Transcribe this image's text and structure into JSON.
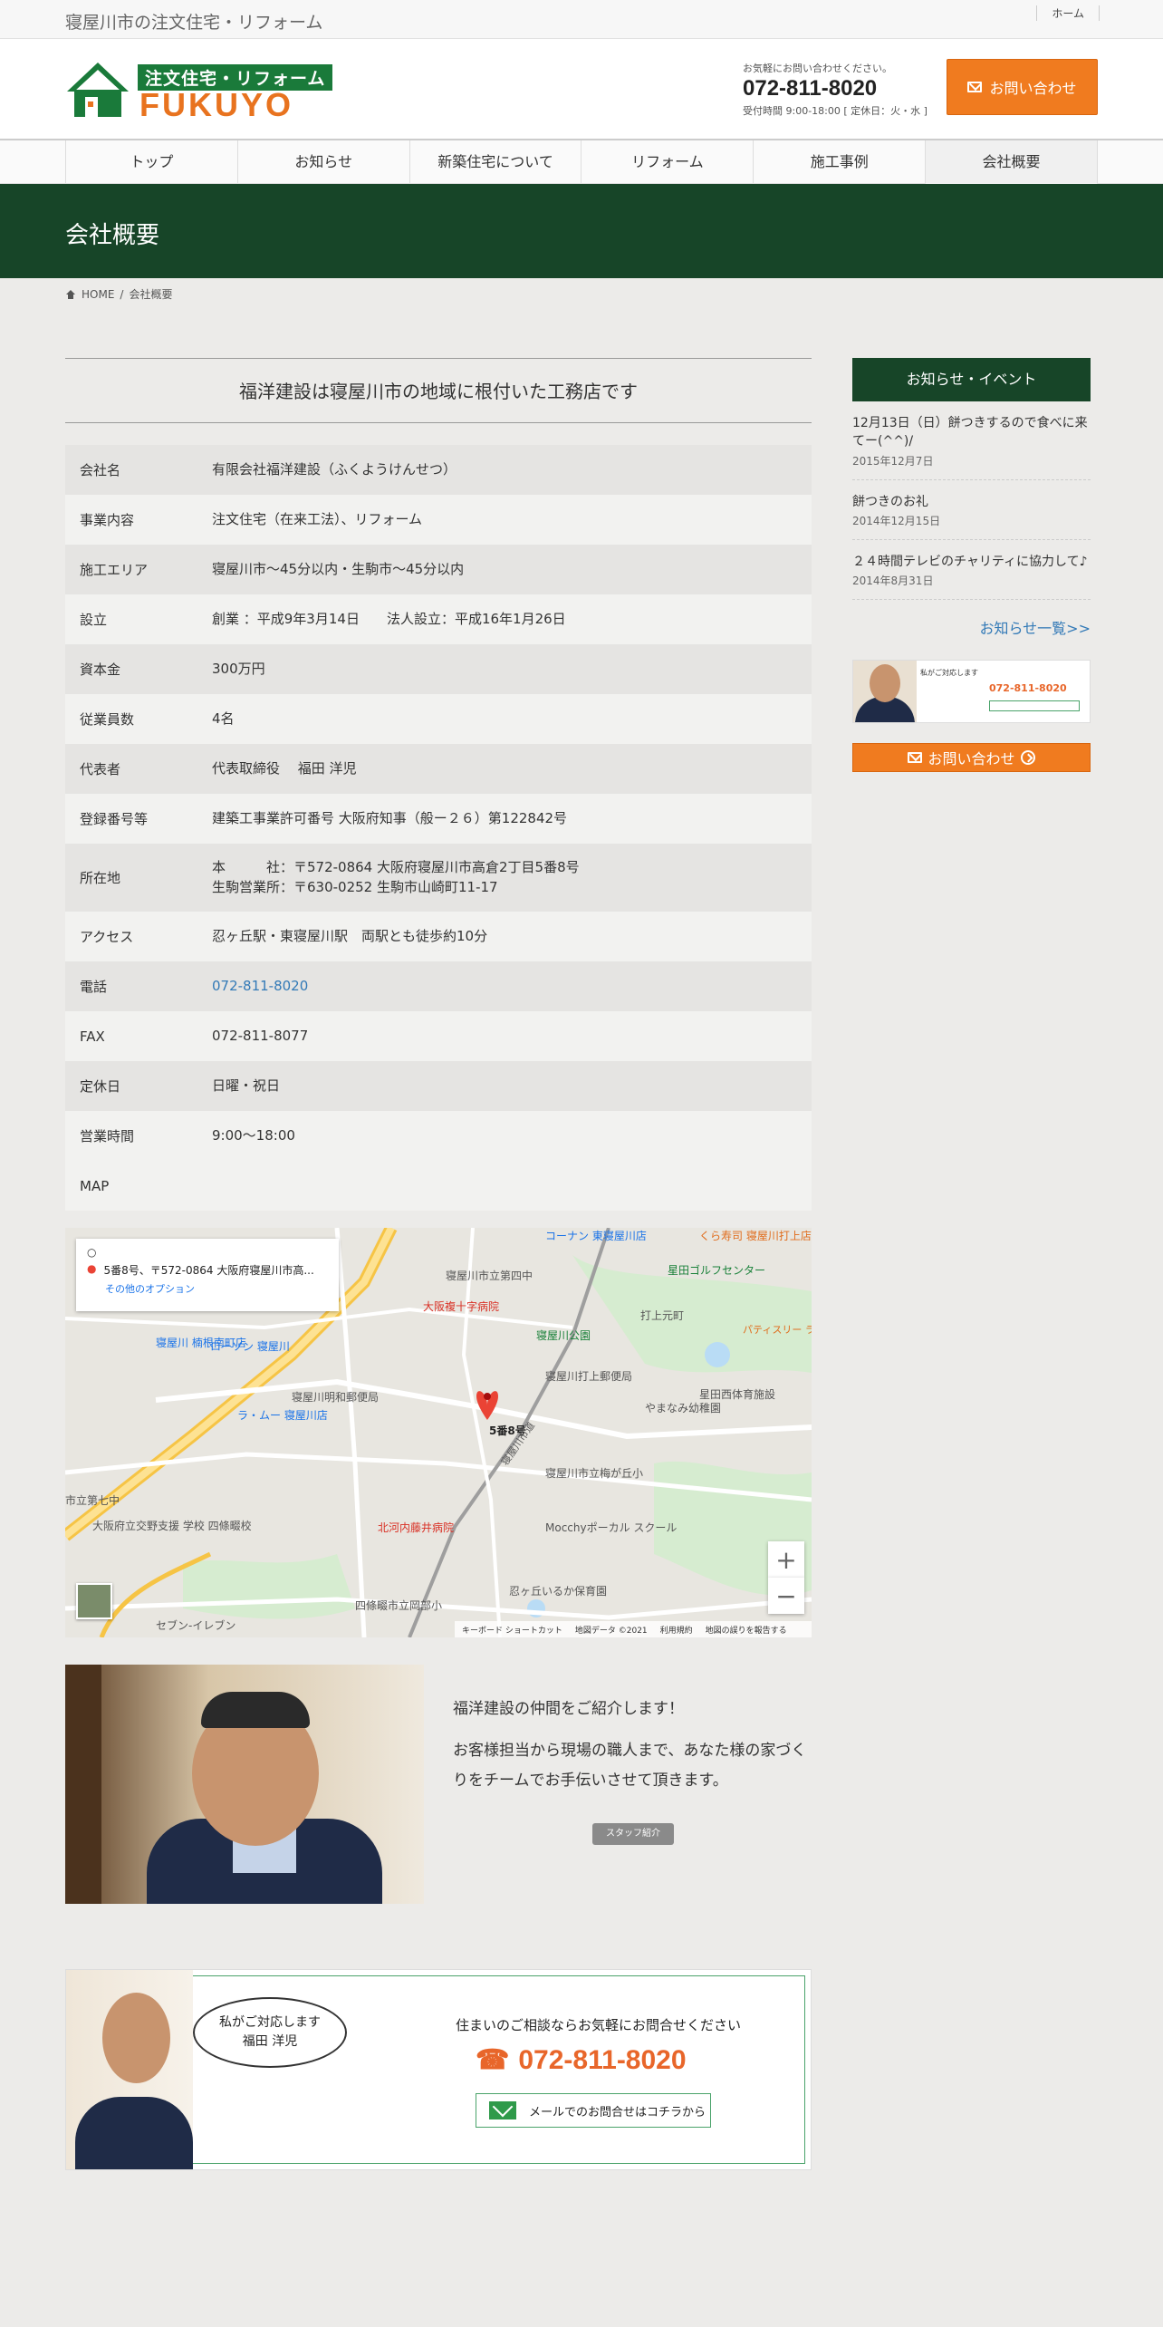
{
  "topbar": {
    "tagline": "寝屋川市の注文住宅・リフォーム",
    "nav_home": "ホーム"
  },
  "header": {
    "logo_sub": "注文住宅・リフォーム",
    "logo_main": "FUKUYO",
    "contact_lead": "お気軽にお問い合わせください。",
    "tel": "072-811-8020",
    "hours": "受付時間 9:00-18:00 [ 定休日：火・水 ]",
    "contact_button": "お問い合わせ"
  },
  "gnav": [
    "トップ",
    "お知らせ",
    "新築住宅について",
    "リフォーム",
    "施工事例",
    "会社概要"
  ],
  "page": {
    "title": "会社概要",
    "breadcrumb_home": "HOME",
    "breadcrumb_current": "会社概要"
  },
  "main": {
    "lead_title": "福洋建設は寝屋川市の地域に根付いた工務店です",
    "table": [
      {
        "k": "会社名",
        "v": "有限会社福洋建設（ふくようけんせつ）"
      },
      {
        "k": "事業内容",
        "v": "注文住宅（在来工法）、リフォーム"
      },
      {
        "k": "施工エリア",
        "v": "寝屋川市～45分以内・生駒市～45分以内"
      },
      {
        "k": "設立",
        "v": "創業 ：平成9年3月14日　　法人設立：平成16年1月26日"
      },
      {
        "k": "資本金",
        "v": "300万円"
      },
      {
        "k": "従業員数",
        "v": "4名"
      },
      {
        "k": "代表者",
        "v": "代表取締役　 福田 洋児"
      },
      {
        "k": "登録番号等",
        "v": "建築工事業許可番号 大阪府知事（般ー２６）第122842号"
      },
      {
        "k": "所在地",
        "v": "本　　　社：〒572-0864 大阪府寝屋川市高倉2丁目5番8号",
        "v2": "生駒営業所：〒630-0252 生駒市山崎町11-17"
      },
      {
        "k": "アクセス",
        "v": "忍ヶ丘駅・東寝屋川駅　両駅とも徒歩約10分"
      },
      {
        "k": "電話",
        "v": "072-811-8020"
      },
      {
        "k": "FAX",
        "v": "072-811-8077"
      },
      {
        "k": "定休日",
        "v": "日曜・祝日"
      },
      {
        "k": "営業時間",
        "v": "9:00～18:00"
      },
      {
        "k": "MAP",
        "v": ""
      }
    ]
  },
  "map": {
    "card_address": "5番8号、〒572-0864 大阪府寝屋川市高...",
    "card_option": "その他のオプション",
    "pin_label": "5番8号",
    "labels": [
      "コーナン 東寝屋川店",
      "くら寿司 寝屋川打上店",
      "寝屋川市立第四中",
      "星田ゴルフセンター",
      "大阪複十字病院",
      "打上元町",
      "寝屋川 楠根南町店",
      "寝屋川公園",
      "パティスリー ラ・ヴィエイユ",
      "星田西体育施設",
      "寝屋川打上郵便局",
      "やまなみ幼稚園",
      "寝屋川明和郵便局",
      "ラ・ムー 寝屋川店",
      "寝屋川市立梅が丘小",
      "北河内藤井病院",
      "Mocchyポーカル スクール",
      "忍ヶ丘いるか保育園",
      "四條畷市立岡部小",
      "セブン-イレブン",
      "ローソン 寝屋川",
      "大阪府立交野支援 学校 四條畷校",
      "市立第七中"
    ],
    "road_label": "寝屋川市道",
    "footer": [
      "キーボード ショートカット",
      "地図データ ©2021",
      "利用規約",
      "地図の誤りを報告する"
    ],
    "zoom_in": "+",
    "zoom_out": "−"
  },
  "staff": {
    "heading": "福洋建設の仲間をご紹介します！",
    "body": "お客様担当から現場の職人まで、あなた様の家づくりをチームでお手伝いさせて頂きます。",
    "button": "スタッフ紹介"
  },
  "banner": {
    "bubble_line1": "私がご対応します",
    "bubble_line2": "福田 洋児",
    "lead": "住まいのご相談ならお気軽にお問合せください",
    "tel": "072-811-8020",
    "mail_button": "メールでのお問合せはコチラから"
  },
  "sidebar": {
    "title": "お知らせ・イベント",
    "news": [
      {
        "title": "12月13日（日）餅つきするので食べに来てー(^^)/",
        "date": "2015年12月7日"
      },
      {
        "title": "餅つきのお礼",
        "date": "2014年12月15日"
      },
      {
        "title": "２４時間テレビのチャリティに協力して♪",
        "date": "2014年8月31日"
      }
    ],
    "more": "お知らせ一覧>>",
    "side_banner_lead": "私がご対応します",
    "side_banner_tel": "072-811-8020",
    "contact_button": "お問い合わせ"
  },
  "colors": {
    "brand_green": "#174528",
    "accent_orange": "#f07b1f",
    "link_blue": "#337ab7"
  }
}
